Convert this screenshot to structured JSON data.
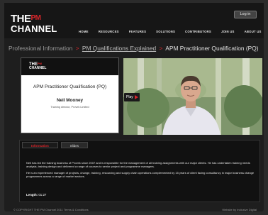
{
  "header": {
    "logo_line1_the": "THE",
    "logo_line1_pm": "PM",
    "logo_line2": "CHANNEL",
    "login_label": "Log in",
    "nav": [
      "HOME",
      "RESOURCES",
      "FEATURES",
      "SOLUTIONS",
      "CONTRIBUTORS",
      "JOIN US",
      "ABOUT US"
    ]
  },
  "breadcrumb": {
    "item1": "Professional Information",
    "separator": ">",
    "item2": "PM Qualifications Explained",
    "item3": "APM Practitioner Qualification (PQ)"
  },
  "card": {
    "logo_the": "THE",
    "logo_pm": "PM",
    "logo_channel": "CHANNEL",
    "title": "APM Practitioner Qualification (PQ)",
    "name": "Neil Mooney",
    "role": "Training director, Provek Limited"
  },
  "video": {
    "play_label": "Play"
  },
  "info": {
    "tabs": [
      "Information",
      "Slides"
    ],
    "paragraphs": [
      "Neil has led the training business of Provek since 2007 and is responsible for the management of all training assignments with our major clients. He has undertaken training needs analysis, training design and delivered a range of courses to senior project and programme managers.",
      "He is an experienced manager of projects, change, training, resourcing and supply chain operations complemented by 15 years of client facing consultancy in major business change programmes across a range of market sectors."
    ],
    "length_label": "Length:",
    "length_value": "01:27"
  },
  "footer": {
    "copyright": "© COPYRIGHT THE PM Channel 2011",
    "terms": "Terms & Conditions",
    "credit": "Website by Inclusive Digital"
  },
  "colors": {
    "accent": "#d7262b",
    "background": "#1e1e1e"
  }
}
